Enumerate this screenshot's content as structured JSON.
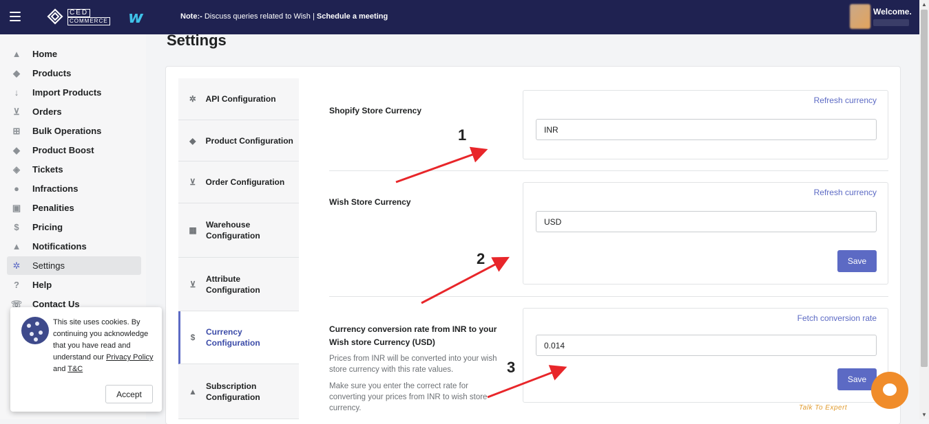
{
  "topbar": {
    "logo_text_top": "CED",
    "logo_text_bottom": "COMMERCE",
    "wish_logo": "w",
    "note_prefix": "Note:-",
    "note_text": " Discuss queries related to Wish | ",
    "note_link": "Schedule a meeting",
    "welcome": "Welcome."
  },
  "sidebar": {
    "items": [
      {
        "label": "Home",
        "icon": "home-icon",
        "glyph": "▲"
      },
      {
        "label": "Products",
        "icon": "tag-icon",
        "glyph": "◆"
      },
      {
        "label": "Import Products",
        "icon": "arrow-down-icon",
        "glyph": "↓"
      },
      {
        "label": "Orders",
        "icon": "inbox-download-icon",
        "glyph": "⊻"
      },
      {
        "label": "Bulk Operations",
        "icon": "grid-plus-icon",
        "glyph": "⊞"
      },
      {
        "label": "Product Boost",
        "icon": "tag-icon",
        "glyph": "◆"
      },
      {
        "label": "Tickets",
        "icon": "ticket-icon",
        "glyph": "◈"
      },
      {
        "label": "Infractions",
        "icon": "alert-circle-icon",
        "glyph": "●"
      },
      {
        "label": "Penalities",
        "icon": "percent-receipt-icon",
        "glyph": "▣"
      },
      {
        "label": "Pricing",
        "icon": "dollar-circle-icon",
        "glyph": "$"
      },
      {
        "label": "Notifications",
        "icon": "bell-icon",
        "glyph": "▲"
      },
      {
        "label": "Settings",
        "icon": "gear-icon",
        "glyph": "✲"
      },
      {
        "label": "Help",
        "icon": "question-circle-icon",
        "glyph": "?"
      },
      {
        "label": "Contact Us",
        "icon": "contact-icon",
        "glyph": "☏"
      }
    ]
  },
  "cookie": {
    "text_before": "This site uses cookies. By continuing you acknowledge that you have read and understand our ",
    "privacy_link": "Privacy Policy",
    "and": " and ",
    "tc_link": "T&C",
    "accept": "Accept"
  },
  "page": {
    "title": "Settings"
  },
  "tabs": [
    {
      "label": "API Configuration",
      "icon": "gear-icon",
      "glyph": "✲"
    },
    {
      "label": "Product Configuration",
      "icon": "tag-icon",
      "glyph": "◆"
    },
    {
      "label": "Order Configuration",
      "icon": "inbox-download-icon",
      "glyph": "⊻"
    },
    {
      "label": "Warehouse Configuration",
      "icon": "store-icon",
      "glyph": "▦"
    },
    {
      "label": "Attribute Configuration",
      "icon": "inbox-download-icon",
      "glyph": "⊻"
    },
    {
      "label": "Currency Configuration",
      "icon": "dollar-circle-icon",
      "glyph": "$"
    },
    {
      "label": "Subscription Configuration",
      "icon": "bell-icon",
      "glyph": "▲"
    }
  ],
  "currency": {
    "shopify": {
      "label": "Shopify Store Currency",
      "link": "Refresh currency",
      "value": "INR"
    },
    "wish": {
      "label": "Wish Store Currency",
      "link": "Refresh currency",
      "value": "USD",
      "save": "Save"
    },
    "conversion": {
      "label": "Currency conversion rate from INR to your Wish store Currency (USD)",
      "hint1": "Prices from INR will be converted into your wish store currency with this rate values.",
      "hint2": "Make sure you enter the correct rate for converting your prices from INR to wish store currency.",
      "link": "Fetch conversion rate",
      "value": "0.014",
      "save": "Save"
    }
  },
  "annotations": {
    "one": "1",
    "two": "2",
    "three": "3",
    "arrow_color": "#e8262a"
  },
  "chat": {
    "label": "Talk To Expert"
  },
  "colors": {
    "topbar": "#1f2251",
    "accent": "#5c6ac4",
    "chat": "#f08c2a"
  }
}
